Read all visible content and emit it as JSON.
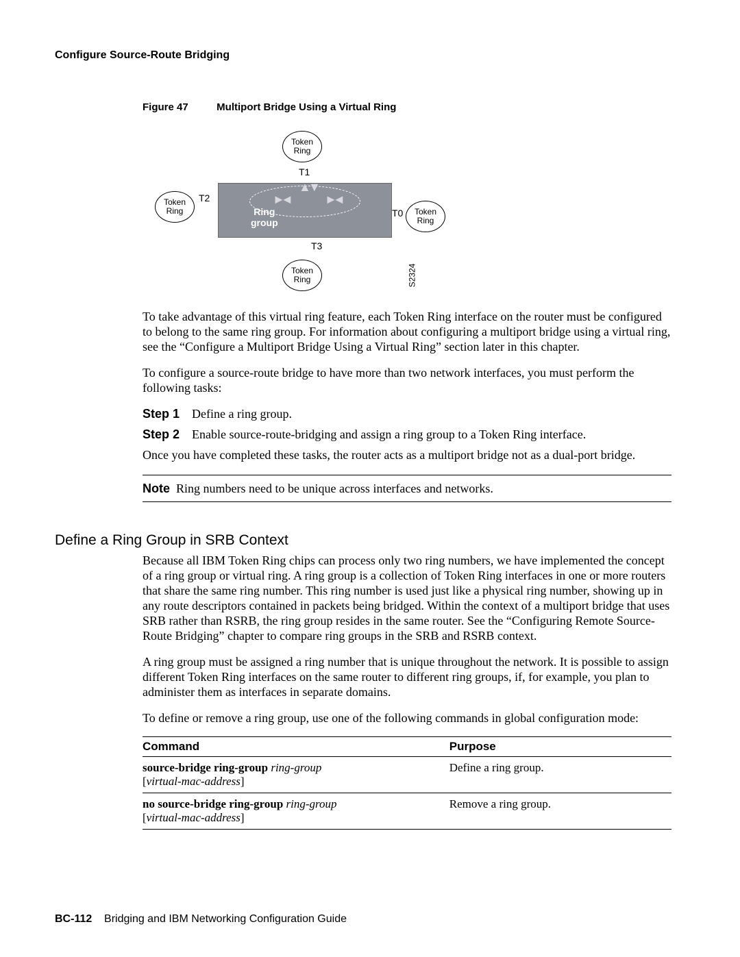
{
  "header": {
    "running_head": "Configure Source-Route Bridging"
  },
  "figure": {
    "label": "Figure 47",
    "caption": "Multiport Bridge Using a Virtual Ring",
    "ring_group": "Ring\ngroup",
    "tr": "Token\nRing",
    "ports": {
      "t0": "T0",
      "t1": "T1",
      "t2": "T2",
      "t3": "T3"
    },
    "id": "S2324"
  },
  "paras": {
    "p1": "To take advantage of this virtual ring feature, each Token Ring interface on the router must be configured to belong to the same ring group. For information about configuring a multiport bridge using a virtual ring, see the “Configure a Multiport Bridge Using a Virtual Ring” section later in this chapter.",
    "p2": "To configure a source-route bridge to have more than two network interfaces, you must perform the following tasks:",
    "step1_label": "Step 1",
    "step1_text": "Define a ring group.",
    "step2_label": "Step 2",
    "step2_text": "Enable source-route-bridging and assign a ring group to a Token Ring interface.",
    "p3": "Once you have completed these tasks, the router acts as a multiport bridge not as a dual-port bridge.",
    "note_label": "Note",
    "note_text": "Ring numbers need to be unique across interfaces and networks."
  },
  "section2": {
    "title": "Define a Ring Group in SRB Context",
    "p1": "Because all IBM Token Ring chips can process only two ring numbers, we have implemented the concept of a ring group or virtual ring. A ring group is a collection of Token Ring interfaces in one or more routers that share the same ring number. This ring number is used just like a physical ring number, showing up in any route descriptors contained in packets being bridged. Within the context of a multiport bridge that uses SRB rather than RSRB, the ring group resides in the same router. See the “Configuring Remote Source-Route Bridging” chapter to compare ring groups in the SRB and RSRB context.",
    "p2": "A ring group must be assigned a ring number that is unique throughout the network. It is possible to assign different Token Ring interfaces on the same router to different ring groups, if, for example, you plan to administer them as interfaces in separate domains.",
    "p3": "To define or remove a ring group, use one of the following commands in global configuration mode:"
  },
  "table": {
    "headers": {
      "c1": "Command",
      "c2": "Purpose"
    },
    "rows": [
      {
        "cmd_bold": "source-bridge ring-group",
        "cmd_arg": "ring-group",
        "cmd_opt": "virtual-mac-address",
        "purpose": "Define a ring group."
      },
      {
        "cmd_bold": "no source-bridge ring-group",
        "cmd_arg": "ring-group",
        "cmd_opt": "virtual-mac-address",
        "purpose": "Remove a ring group."
      }
    ]
  },
  "footer": {
    "page": "BC-112",
    "book": "Bridging and IBM Networking Configuration Guide"
  }
}
